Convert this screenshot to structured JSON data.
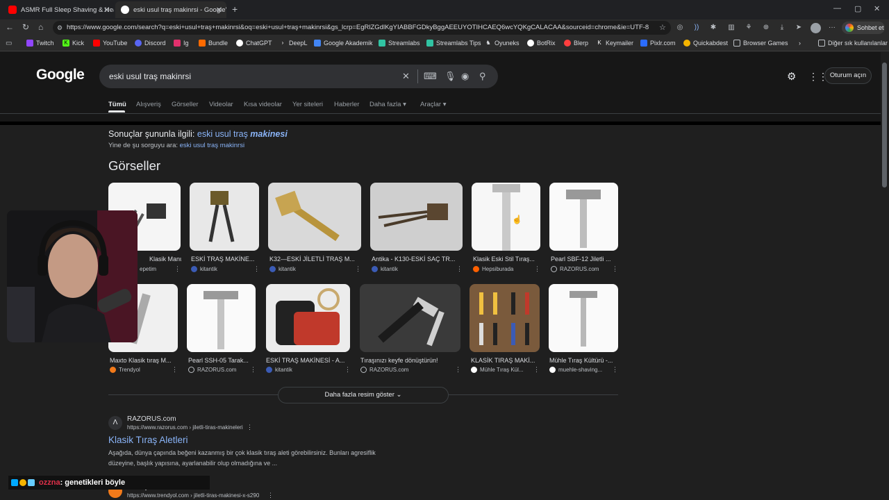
{
  "browser": {
    "tabs": [
      {
        "title": "ASMR Full Sleep Shaving & Head",
        "active": false
      },
      {
        "title": "eski usul traş makinrsi - Google'da",
        "active": true
      }
    ],
    "url": "https://www.google.com/search?q=eski+usul+traş+makinrsi&oq=eski+usul+traş+makinrsi&gs_lcrp=EgRlZGdlKgYIABBFGDkyBggAEEUYOTIHCAEQ6wcYQKgCALACAA&sourceid=chrome&ie=UTF-8",
    "chat_button": "Sohbet et",
    "bookmarks": [
      "Twitch",
      "Kick",
      "YouTube",
      "Discord",
      "Ig",
      "Bundle",
      "ChatGPT",
      "DeepL",
      "Google Akademik",
      "Streamlabs",
      "Streamlabs Tips",
      "Oyuneks",
      "BotRix",
      "Blerp",
      "Keymailer",
      "Pixlr.com",
      "Quickabdest",
      "Browser Games"
    ],
    "other_bookmarks": "Diğer sık kullanılanlar"
  },
  "google": {
    "logo": "Google",
    "query": "eski usul traş makinrsi",
    "signin": "Oturum açın",
    "filters": [
      "Tümü",
      "Alışveriş",
      "Görseller",
      "Videolar",
      "Kısa videolar",
      "Yer siteleri",
      "Haberler",
      "Daha fazla",
      "Araçlar"
    ],
    "correction_prefix": "Sonuçlar şununla ilgili:",
    "correction_plain": "eski usul traş ",
    "correction_bold": "makinesi",
    "original_prefix": "Yine de şu sorguyu ara:",
    "original_query": "eski usul traş makinrsi",
    "images_heading": "Görseller",
    "images_row1": [
      {
        "caption": "Klasik Manuel S...",
        "source": "epetim"
      },
      {
        "caption": "ESKİ TRAŞ MAKİNE...",
        "source": "kitantik"
      },
      {
        "caption": "K32—ESKİ JİLETLİ TRAŞ M...",
        "source": "kitantik"
      },
      {
        "caption": "Antika - K130-ESKİ SAÇ TR...",
        "source": "kitantik"
      },
      {
        "caption": "Klasik Eski Stil Tıraş...",
        "source": "Hepsiburada"
      },
      {
        "caption": "Pearl SBF-12 Jiletli ...",
        "source": "RAZORUS.com"
      }
    ],
    "images_row2": [
      {
        "caption": "Maxto Klasik tıraş M...",
        "source": "Trendyol"
      },
      {
        "caption": "Pearl SSH-05 Tarak...",
        "source": "RAZORUS.com"
      },
      {
        "caption": "ESKİ TRAŞ MAKİNESİ - A...",
        "source": "kitantik"
      },
      {
        "caption": "Tıraşınızı keyfe dönüştürün!",
        "source": "RAZORUS.com"
      },
      {
        "caption": "KLASİK TIRAŞ MAKİ...",
        "source": "Mühle Tıraş Kül..."
      },
      {
        "caption": "Mühle Tıraş Kültürü -...",
        "source": "muehle-shaving..."
      }
    ],
    "more_images": "Daha fazla resim göster",
    "result1": {
      "site": "RAZORUS.com",
      "url": "https://www.razorus.com › jiletli-tiras-makineleri",
      "title": "Klasik Tıraş Aletleri",
      "snippet1": "Aşağıda, dünya çapında beğeni kazanmış bir çok klasik tıraş aleti görebilirsiniz. Bunları agresiflik",
      "snippet2": "düzeyine, başlık yapısına, ayarlanabilir olup olmadığına ve ..."
    },
    "result2": {
      "site": "Trendyol",
      "url": "https://www.trendyol.com › jiletli-tiras-makinesi-x-s290"
    }
  },
  "chat_overlay": {
    "user": "ozzna",
    "message": ": genetikleri böyle"
  },
  "colors": {
    "link": "#8ab4f8",
    "page_bg": "#1f1f1f",
    "header_bg": "#171717"
  }
}
